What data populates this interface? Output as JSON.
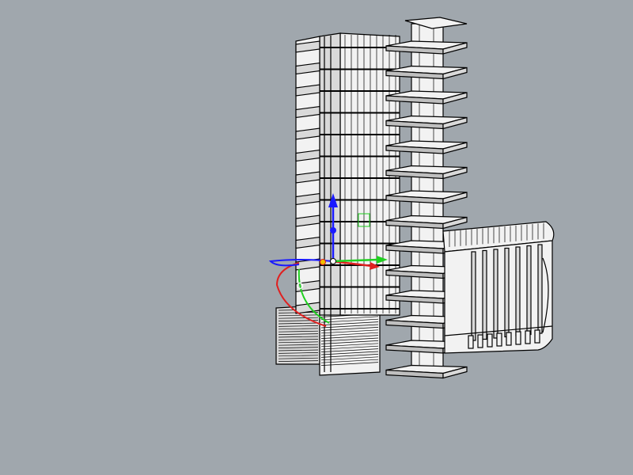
{
  "viewport": {
    "background": "#a0a7ad",
    "view": "perspective"
  },
  "model": {
    "object": "building-model",
    "tower_a_floors": 13,
    "tower_b_floors": 14,
    "annex_columns": 7,
    "line_color": "#000000",
    "surface_color": "#f2f2f2"
  },
  "gumball": {
    "x_axis_color": "#e02020",
    "y_axis_color": "#20d020",
    "z_axis_color": "#1a1aff",
    "icons": [
      "move-arrow-x-icon",
      "move-arrow-y-icon",
      "move-arrow-z-icon",
      "rotate-x-icon",
      "rotate-y-icon",
      "rotate-z-icon",
      "scale-handle-icon"
    ]
  }
}
